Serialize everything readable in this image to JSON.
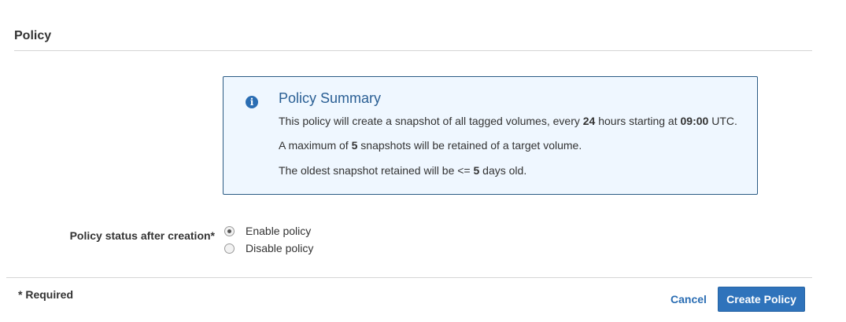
{
  "section": {
    "title": "Policy"
  },
  "summary": {
    "icon": "info-icon",
    "icon_glyph": "i",
    "title": "Policy Summary",
    "line1": {
      "prefix": "This policy will create a snapshot of all tagged volumes, every ",
      "interval": "24",
      "middle": " hours starting at ",
      "time": "09:00",
      "suffix": " UTC."
    },
    "line2": {
      "prefix": "A maximum of ",
      "count": "5",
      "suffix": " snapshots will be retained of a target volume."
    },
    "line3": {
      "prefix": "The oldest snapshot retained will be <= ",
      "days": "5",
      "suffix": " days old."
    }
  },
  "status": {
    "label": "Policy status after creation*",
    "options": [
      {
        "label": "Enable policy",
        "selected": true
      },
      {
        "label": "Disable policy",
        "selected": false
      }
    ]
  },
  "footer": {
    "required_note": "* Required",
    "cancel_label": "Cancel",
    "create_label": "Create Policy"
  },
  "colors": {
    "accent": "#2f73bb",
    "summary_bg": "#eff7ff",
    "summary_border": "#2b5b84",
    "summary_title": "#2a5f94"
  }
}
